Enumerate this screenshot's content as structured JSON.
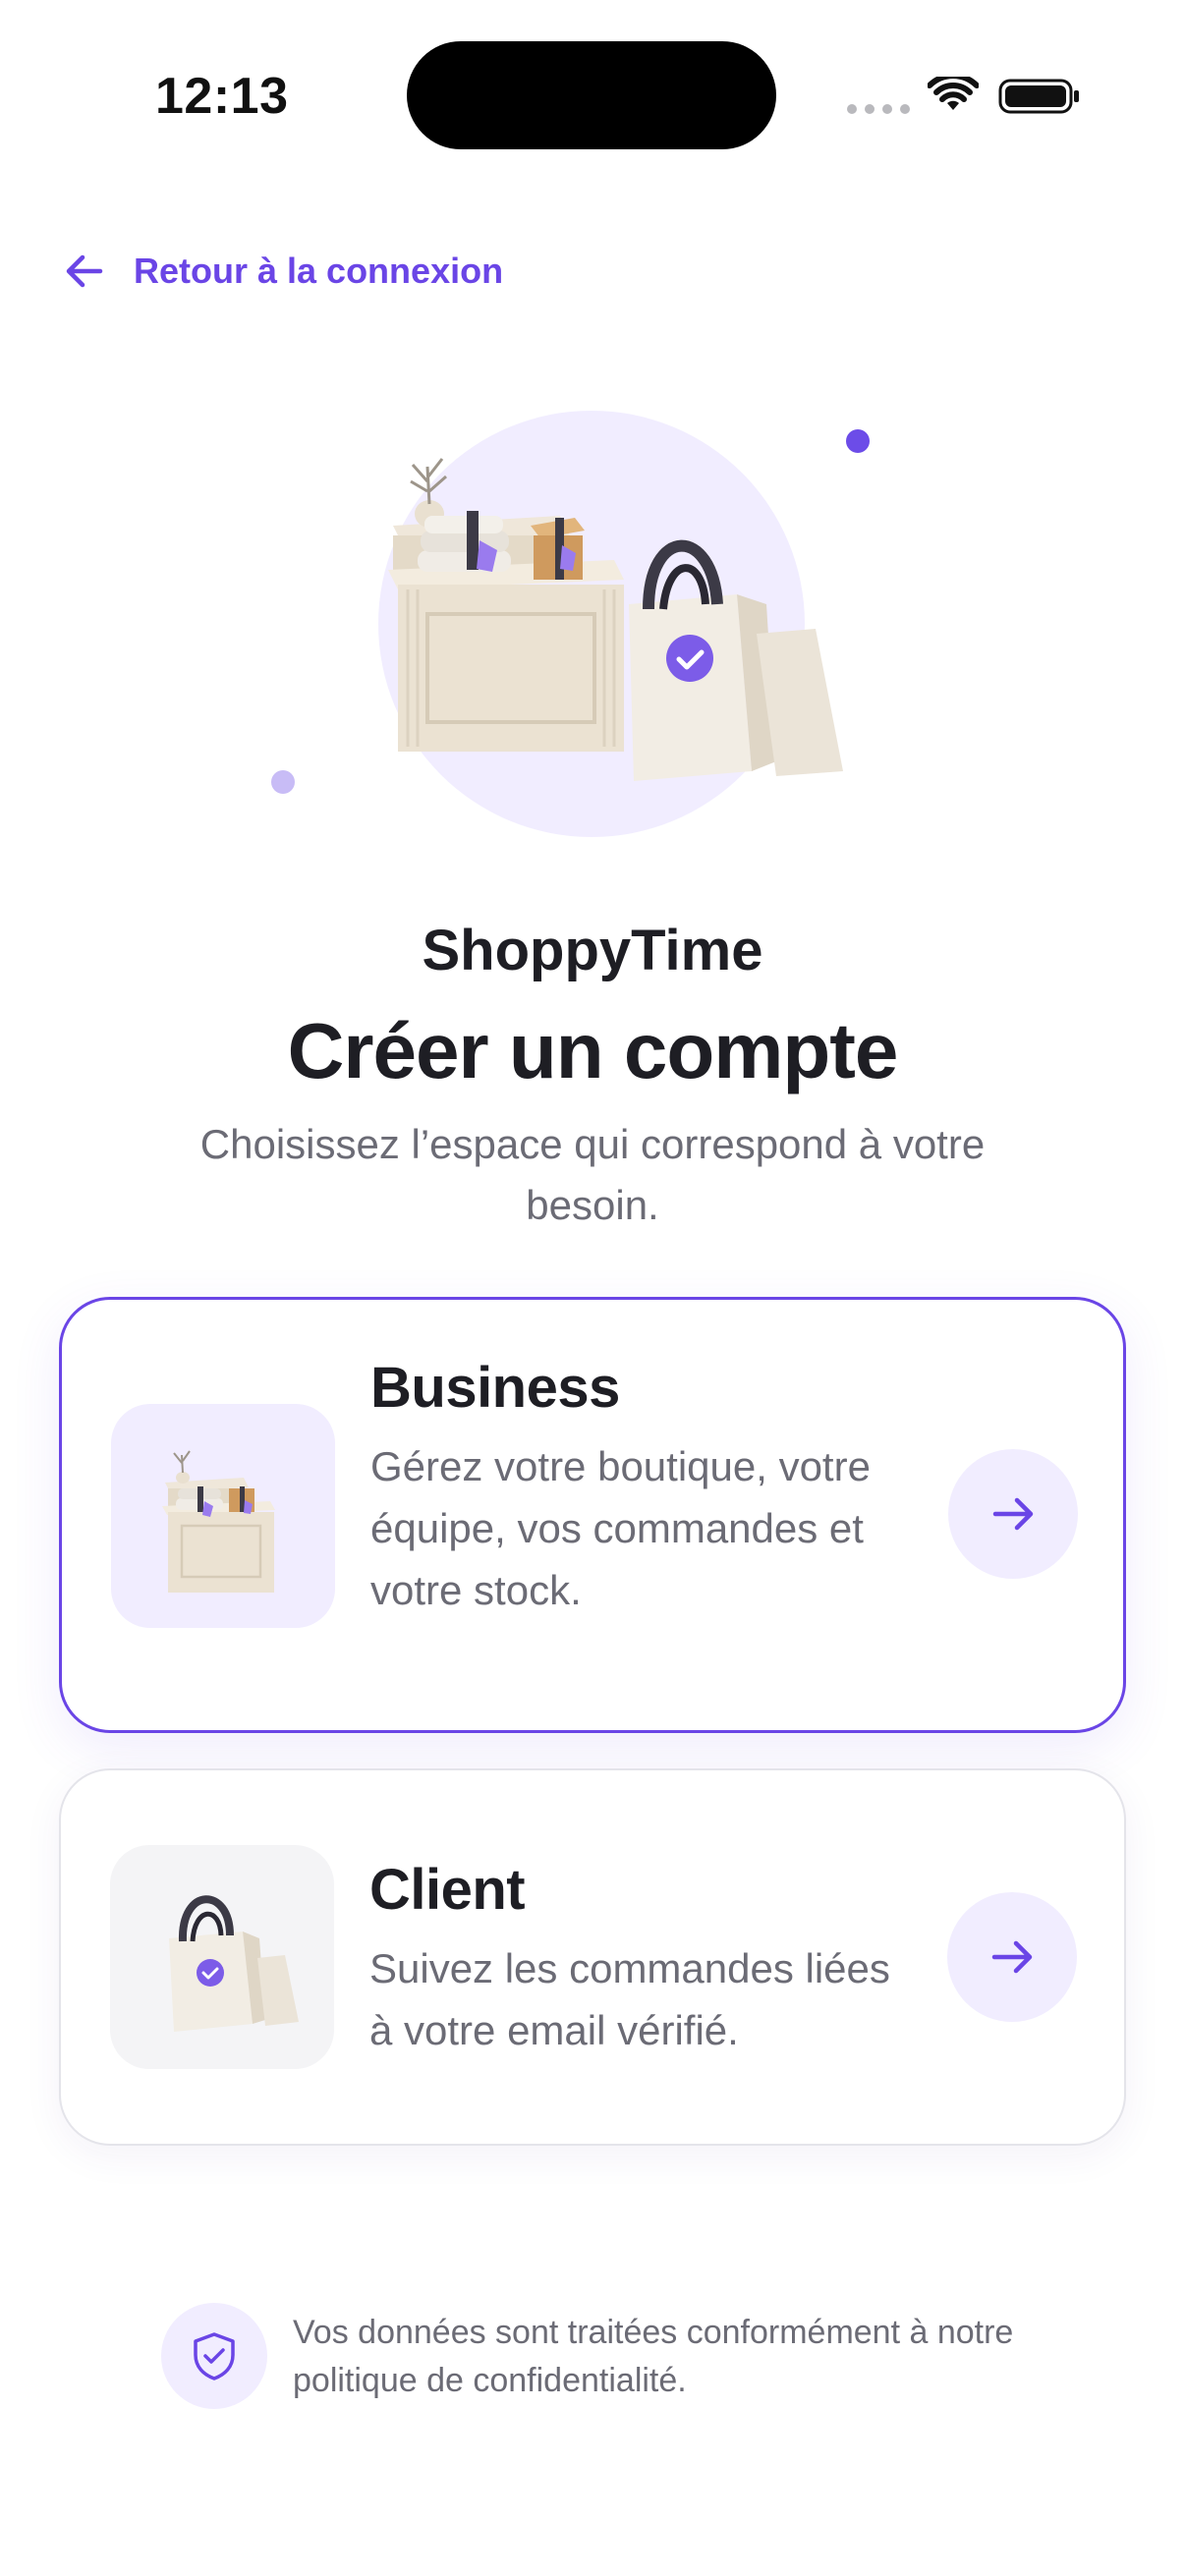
{
  "status_bar": {
    "time": "12:13",
    "icons": [
      "signal-dots-icon",
      "wifi-icon",
      "battery-icon"
    ]
  },
  "back_link": {
    "label": "Retour à la connexion",
    "icon": "arrow-left-icon"
  },
  "header": {
    "brand": "ShoppyTime",
    "title": "Créer un compte",
    "subtitle": "Choisissez l’espace qui correspond à votre besoin."
  },
  "options": [
    {
      "title": "Business",
      "description": "Gérez votre boutique, votre équipe, vos commandes et votre stock.",
      "icon": "shop-counter-icon",
      "selected": true
    },
    {
      "title": "Client",
      "description": "Suivez les commandes liées à votre email vérifié.",
      "icon": "shopping-bag-icon",
      "selected": false
    }
  ],
  "privacy": {
    "text": "Vos données sont traitées conformément à notre politique de confidentialité.",
    "icon": "shield-check-icon"
  },
  "colors": {
    "accent": "#6a45e6",
    "accent_soft": "#f1edff",
    "text_primary": "#1e1e24",
    "text_secondary": "#6b6b75"
  }
}
